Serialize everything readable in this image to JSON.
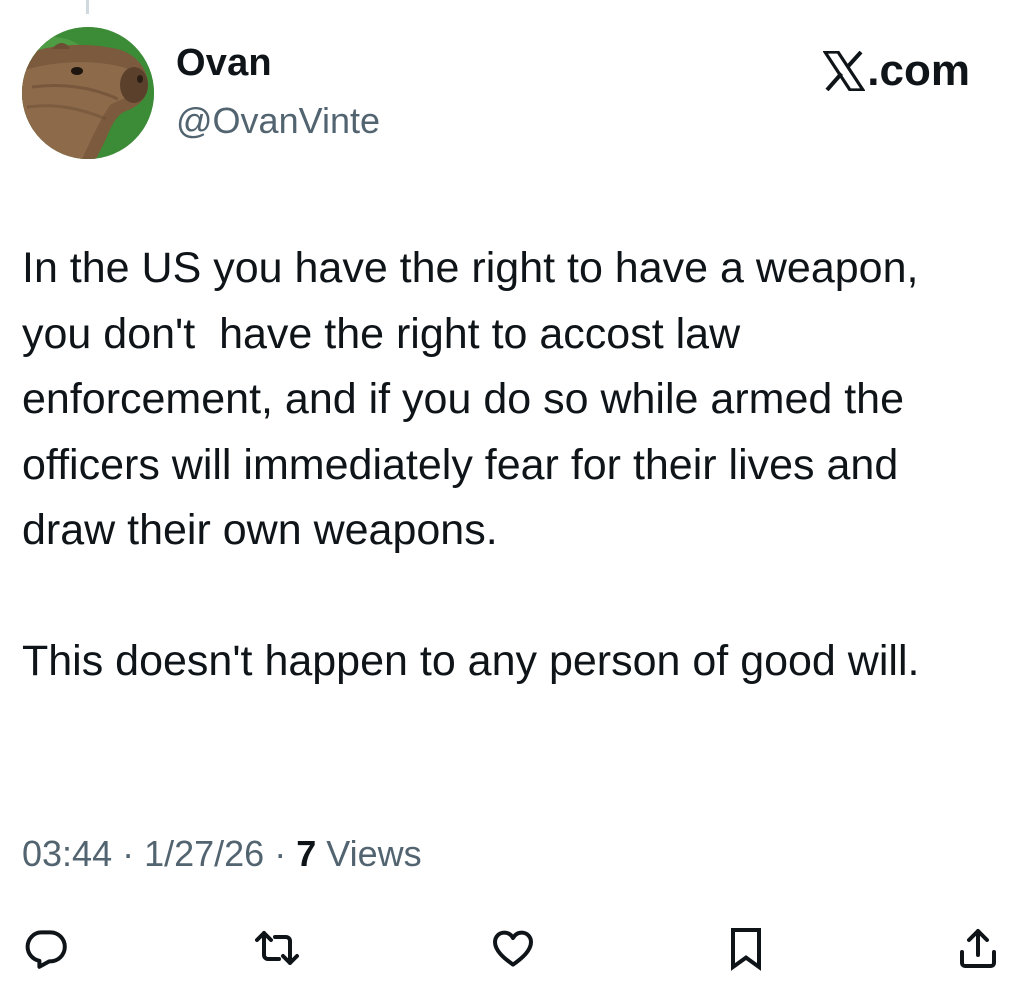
{
  "post": {
    "author": {
      "display_name": "Ovan",
      "handle": "@OvanVinte"
    },
    "site_label": ".com",
    "paragraphs": [
      "In the US you have the right to have a weapon, you don't  have the right to accost law enforcement, and if you do so while armed the officers will immediately fear for their lives and draw their own weapons.",
      "This doesn't happen to any person of good will."
    ],
    "meta": {
      "time": "03:44",
      "separator": " · ",
      "date": "1/27/26",
      "views_count": "7",
      "views_label": "Views"
    }
  },
  "actions": [
    {
      "name": "reply",
      "icon": "speech-bubble-icon"
    },
    {
      "name": "repost",
      "icon": "repost-arrows-icon"
    },
    {
      "name": "like",
      "icon": "heart-icon"
    },
    {
      "name": "bookmark",
      "icon": "bookmark-icon"
    },
    {
      "name": "share",
      "icon": "share-upload-icon"
    }
  ],
  "colors": {
    "text_primary": "#0f1419",
    "text_secondary": "#536471",
    "background": "#ffffff"
  }
}
